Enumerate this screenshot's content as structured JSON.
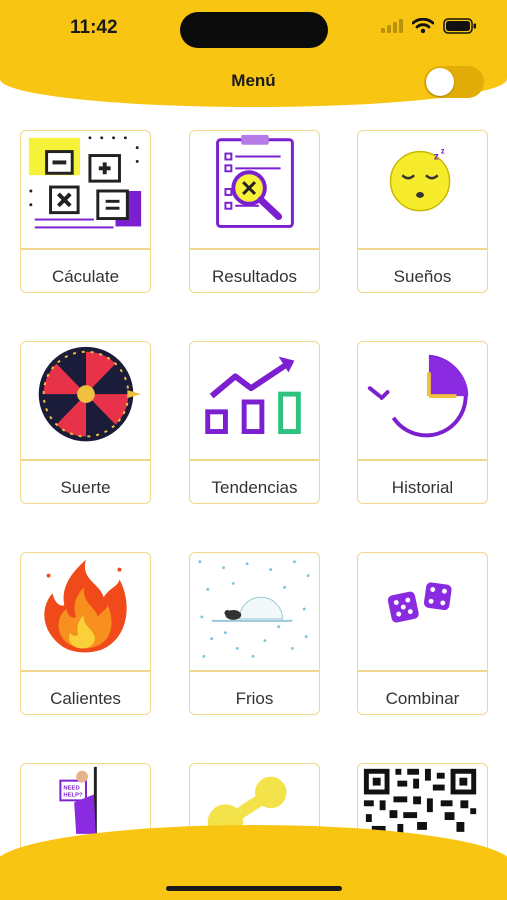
{
  "status_bar": {
    "time": "11:42"
  },
  "header": {
    "title": "Menú",
    "toggle_on": false
  },
  "menu": {
    "items": [
      {
        "label": "Cáculate",
        "icon": "calculator-icon"
      },
      {
        "label": "Resultados",
        "icon": "clipboard-results-icon"
      },
      {
        "label": "Sueños",
        "icon": "sleeping-face-icon"
      },
      {
        "label": "Suerte",
        "icon": "roulette-wheel-icon"
      },
      {
        "label": "Tendencias",
        "icon": "trend-chart-icon"
      },
      {
        "label": "Historial",
        "icon": "history-clock-icon"
      },
      {
        "label": "Calientes",
        "icon": "fire-icon"
      },
      {
        "label": "Frios",
        "icon": "igloo-icon"
      },
      {
        "label": "Combinar",
        "icon": "dice-icon"
      },
      {
        "label": "",
        "icon": "help-person-icon"
      },
      {
        "label": "",
        "icon": "share-icon"
      },
      {
        "label": "",
        "icon": "qr-code-icon"
      }
    ]
  },
  "colors": {
    "brand_yellow": "#f8c612",
    "accent_purple": "#7b1fd0",
    "card_border": "#f1d88a"
  }
}
